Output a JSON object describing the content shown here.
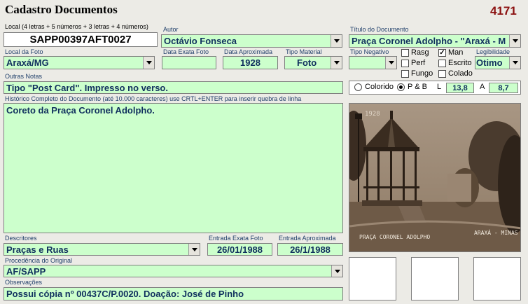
{
  "header": {
    "title": "Cadastro Documentos",
    "record_number": "4171"
  },
  "labels": {
    "local": "Local (4 letras + 5 números + 3 letras + 4 números)",
    "autor": "Autor",
    "titulo": "Título do Documento",
    "local_foto": "Local da Foto",
    "data_exata_foto": "Data Exata Foto",
    "data_aproximada": "Data Aproximada",
    "tipo_material": "Tipo Material",
    "tipo_negativo": "Tipo Negativo",
    "legibilidade": "Legibilidade",
    "outras_notas": "Outras Notas",
    "historico": "Histórico Completo do Documento (até 10.000 caracteres) use CRTL+ENTER para inserir quebra de linha",
    "descritores": "Descritores",
    "entrada_exata_foto": "Entrada Exata Foto",
    "entrada_aproximada": "Entrada Aproximada",
    "procedencia": "Procedência do Original",
    "observacoes": "Observações"
  },
  "fields": {
    "local": "SAPP00397AFT0027",
    "autor": "Octávio Fonseca",
    "titulo": "Praça Coronel Adolpho - \"Araxá - M",
    "local_foto": "Araxá/MG",
    "data_exata_foto": "",
    "data_aproximada": "1928",
    "tipo_material": "Foto",
    "tipo_negativo": "",
    "legibilidade": "Otimo",
    "outras_notas": "Tipo \"Post Card\". Impresso no verso.",
    "historico": "Coreto da Praça Coronel Adolpho.",
    "descritores": "Praças e Ruas",
    "entrada_exata_foto": "26/01/1988",
    "entrada_aproximada": "26/1/1988",
    "procedencia": "AF/SAPP",
    "observacoes": "Possui cópia nº 00437C/P.0020. Doação: José de Pinho"
  },
  "checkboxes": {
    "rasg": {
      "label": "Rasg",
      "checked": false
    },
    "man": {
      "label": "Man",
      "checked": true
    },
    "perf": {
      "label": "Perf",
      "checked": false
    },
    "escrito": {
      "label": "Escrito",
      "checked": false
    },
    "fungo": {
      "label": "Fungo",
      "checked": false
    },
    "colado": {
      "label": "Colado",
      "checked": false
    }
  },
  "color_mode": {
    "colorido_label": "Colorido",
    "pb_label": "P & B",
    "selected": "P & B"
  },
  "dimensions": {
    "l_label": "L",
    "l_value": "13,8",
    "a_label": "A",
    "a_value": "8,7"
  },
  "photo": {
    "caption_left": "PRAÇA CORONEL ADOLPHO",
    "caption_right": "ARAXÁ - MINAS",
    "corner_text": "1928"
  },
  "colors": {
    "field_bg": "#ccffcc",
    "title_red": "#8b1010",
    "label_blue": "#1f3f6a"
  }
}
